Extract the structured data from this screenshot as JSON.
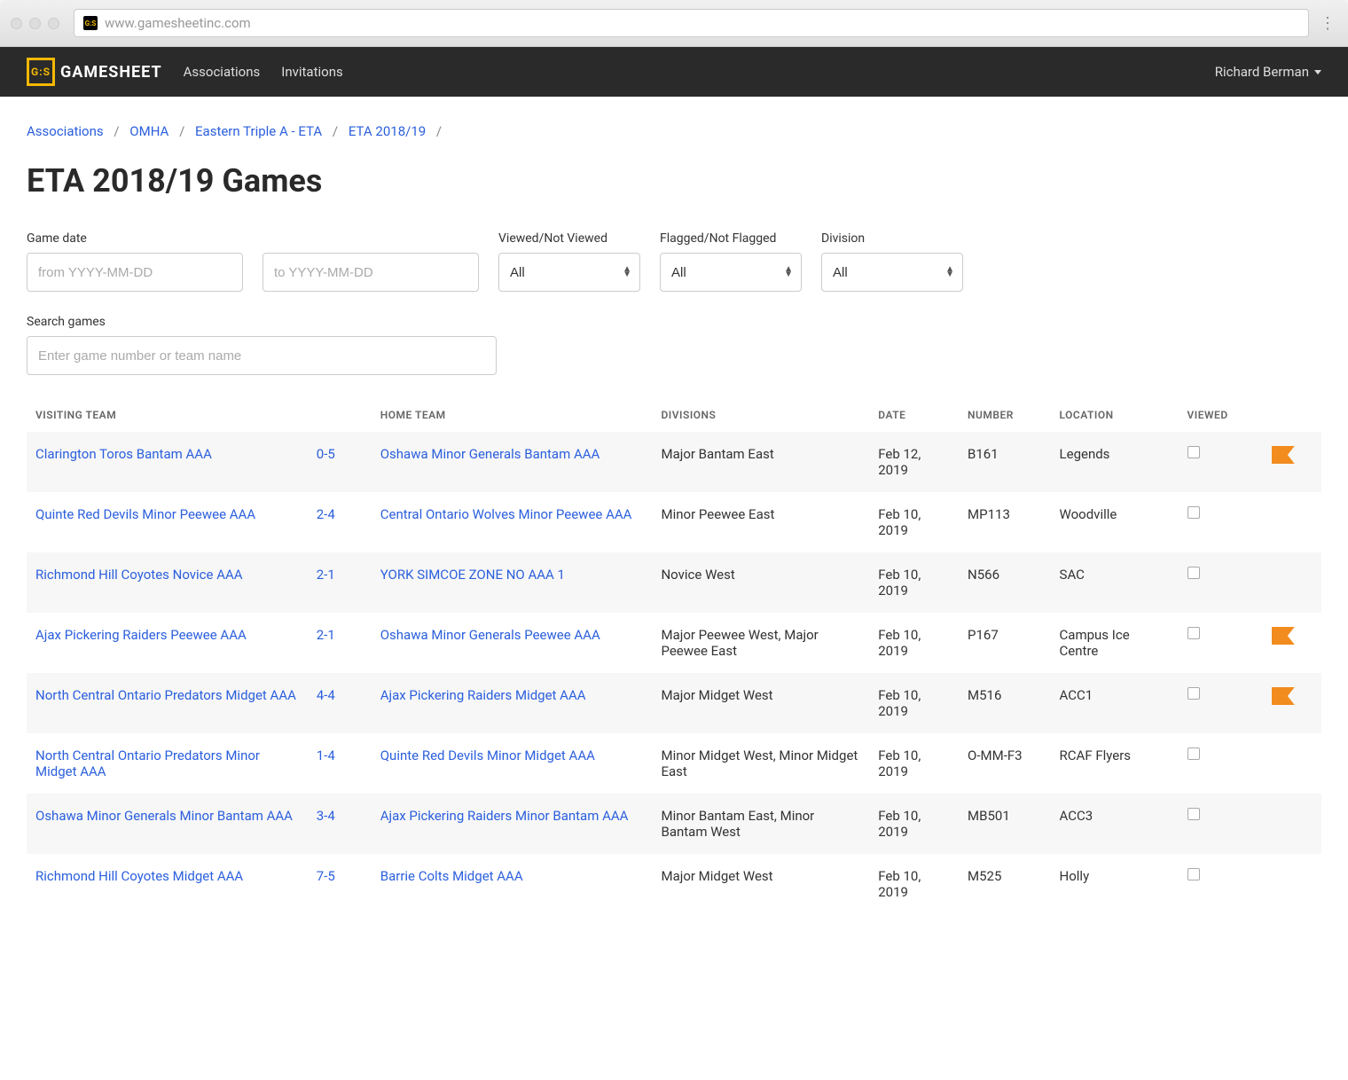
{
  "browser": {
    "url": "www.gamesheetinc.com"
  },
  "brand": {
    "name": "GAMESHEET",
    "badge": "G:S"
  },
  "nav": {
    "associations": "Associations",
    "invitations": "Invitations"
  },
  "user": {
    "name": "Richard Berman"
  },
  "breadcrumb": {
    "items": [
      "Associations",
      "OMHA",
      "Eastern Triple A - ETA",
      "ETA 2018/19"
    ]
  },
  "page_title": "ETA 2018/19 Games",
  "filters": {
    "game_date_label": "Game date",
    "from_placeholder": "from YYYY-MM-DD",
    "to_placeholder": "to YYYY-MM-DD",
    "viewed_label": "Viewed/Not Viewed",
    "viewed_value": "All",
    "flagged_label": "Flagged/Not Flagged",
    "flagged_value": "All",
    "division_label": "Division",
    "division_value": "All",
    "search_label": "Search games",
    "search_placeholder": "Enter game number or team name"
  },
  "table": {
    "headers": {
      "visiting": "Visiting Team",
      "home": "Home Team",
      "divisions": "Divisions",
      "date": "Date",
      "number": "Number",
      "location": "Location",
      "viewed": "Viewed"
    },
    "rows": [
      {
        "visiting": "Clarington Toros Bantam AAA",
        "score": "0-5",
        "home": "Oshawa Minor Generals Bantam AAA",
        "divisions": "Major Bantam East",
        "date": "Feb 12, 2019",
        "number": "B161",
        "location": "Legends",
        "viewed": false,
        "flagged": true
      },
      {
        "visiting": "Quinte Red Devils Minor Peewee AAA",
        "score": "2-4",
        "home": "Central Ontario Wolves Minor Peewee AAA",
        "divisions": "Minor Peewee East",
        "date": "Feb 10, 2019",
        "number": "MP113",
        "location": "Woodville",
        "viewed": false,
        "flagged": false
      },
      {
        "visiting": "Richmond Hill Coyotes Novice AAA",
        "score": "2-1",
        "home": "YORK SIMCOE ZONE NO AAA 1",
        "divisions": "Novice West",
        "date": "Feb 10, 2019",
        "number": "N566",
        "location": "SAC",
        "viewed": false,
        "flagged": false
      },
      {
        "visiting": "Ajax Pickering Raiders Peewee AAA",
        "score": "2-1",
        "home": "Oshawa Minor Generals Peewee AAA",
        "divisions": "Major Peewee West, Major Peewee East",
        "date": "Feb 10, 2019",
        "number": "P167",
        "location": "Campus Ice Centre",
        "viewed": false,
        "flagged": true
      },
      {
        "visiting": "North Central Ontario Predators Midget AAA",
        "score": "4-4",
        "home": "Ajax Pickering Raiders Midget AAA",
        "divisions": "Major Midget West",
        "date": "Feb 10, 2019",
        "number": "M516",
        "location": "ACC1",
        "viewed": false,
        "flagged": true
      },
      {
        "visiting": "North Central Ontario Predators Minor Midget AAA",
        "score": "1-4",
        "home": "Quinte Red Devils Minor Midget AAA",
        "divisions": "Minor Midget West, Minor Midget East",
        "date": "Feb 10, 2019",
        "number": "O-MM-F3",
        "location": "RCAF Flyers",
        "viewed": false,
        "flagged": false
      },
      {
        "visiting": "Oshawa Minor Generals Minor Bantam AAA",
        "score": "3-4",
        "home": "Ajax Pickering Raiders Minor Bantam AAA",
        "divisions": "Minor Bantam East, Minor Bantam West",
        "date": "Feb 10, 2019",
        "number": "MB501",
        "location": "ACC3",
        "viewed": false,
        "flagged": false
      },
      {
        "visiting": "Richmond Hill Coyotes Midget AAA",
        "score": "7-5",
        "home": "Barrie Colts Midget AAA",
        "divisions": "Major Midget West",
        "date": "Feb 10, 2019",
        "number": "M525",
        "location": "Holly",
        "viewed": false,
        "flagged": false
      }
    ]
  }
}
